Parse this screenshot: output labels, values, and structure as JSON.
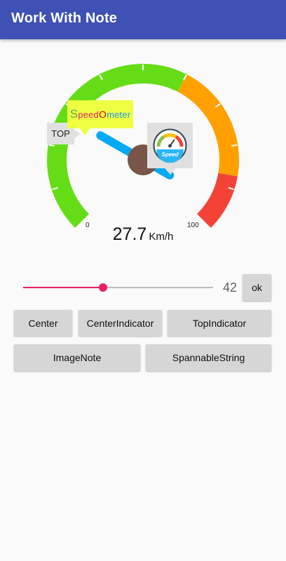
{
  "app_bar": {
    "title": "Work With Note"
  },
  "gauge": {
    "min_label": "0",
    "max_label": "100",
    "speed_value": "27.7",
    "unit": "Km/h",
    "speed": 27.7,
    "sections": [
      {
        "range": [
          0,
          60
        ],
        "color": "#64dd17"
      },
      {
        "range": [
          60,
          87
        ],
        "color": "#ffa000"
      },
      {
        "range": [
          87,
          100
        ],
        "color": "#f44336"
      }
    ],
    "indicator_color": "#03a9f4",
    "center_circle_color": "#795548"
  },
  "notes": {
    "top_note": "TOP",
    "spannable": {
      "p1": "S",
      "p2": "peed",
      "p3": "O",
      "p4": "meter"
    },
    "image_note": {
      "icon": "speed-logo-icon",
      "text": "Speed"
    }
  },
  "slider": {
    "value": "42",
    "fraction": 0.42,
    "color": "#e91e63"
  },
  "buttons": {
    "ok": "ok",
    "center": "Center",
    "center_indicator": "CenterIndicator",
    "top_indicator": "TopIndicator",
    "image_note": "ImageNote",
    "spannable_string": "SpannableString"
  }
}
